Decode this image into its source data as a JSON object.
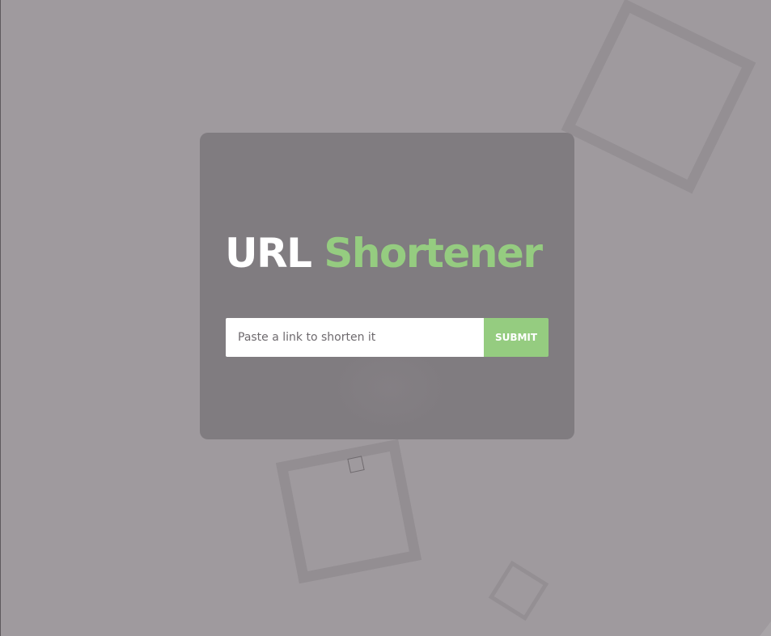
{
  "page": {
    "title_part_1": "URL",
    "title_part_2": "Shortener",
    "input_placeholder": "Paste a link to shorten it",
    "input_value": "",
    "submit_label": "SUBMIT"
  },
  "colors": {
    "background": "#9f9a9e",
    "card": "#807c80",
    "accent": "#95cc80",
    "title_primary": "#ffffff",
    "input_bg": "#ffffff"
  }
}
